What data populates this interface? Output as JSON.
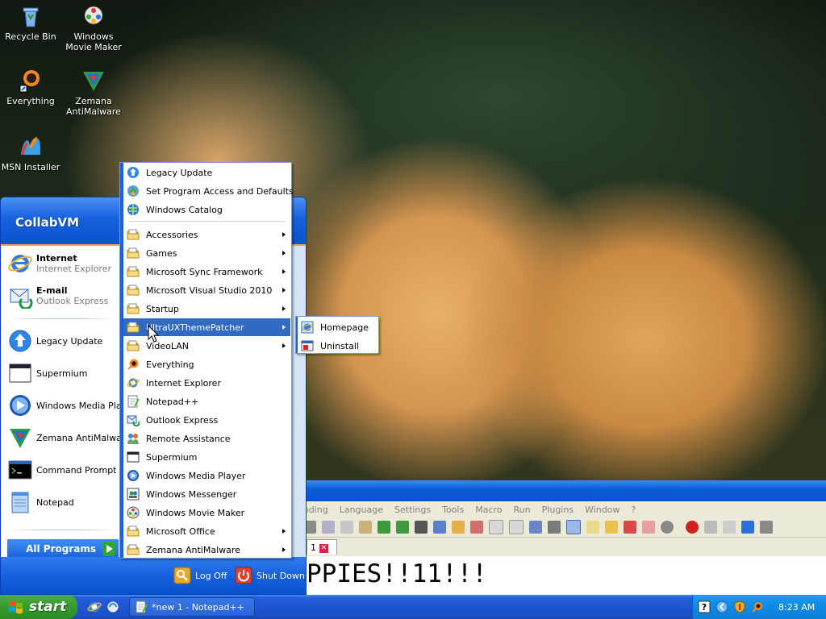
{
  "desktop": {
    "icons": [
      {
        "label": "Recycle Bin",
        "icon": "recycle-bin-icon"
      },
      {
        "label": "Windows Movie Maker",
        "icon": "movie-maker-icon"
      },
      {
        "label": "Everything",
        "icon": "everything-icon"
      },
      {
        "label": "Zemana AntiMalware",
        "icon": "zemana-icon"
      },
      {
        "label": "MSN Installer",
        "icon": "msn-icon"
      }
    ]
  },
  "notepadpp": {
    "menu": [
      "Encoding",
      "Language",
      "Settings",
      "Tools",
      "Macro",
      "Run",
      "Plugins",
      "Window",
      "?"
    ],
    "tab_label": "1",
    "editor_text": "PPIES!!11!!!"
  },
  "start_menu": {
    "user": "CollabVM",
    "pinned": [
      {
        "title": "Internet",
        "subtitle": "Internet Explorer",
        "icon": "internet-explorer-icon"
      },
      {
        "title": "E-mail",
        "subtitle": "Outlook Express",
        "icon": "outlook-express-icon"
      }
    ],
    "recent": [
      {
        "label": "Legacy Update",
        "icon": "legacy-update-icon"
      },
      {
        "label": "Supermium",
        "icon": "supermium-icon"
      },
      {
        "label": "Windows Media Player",
        "icon": "media-player-icon"
      },
      {
        "label": "Zemana AntiMalware",
        "icon": "zemana-icon"
      },
      {
        "label": "Command Prompt",
        "icon": "command-prompt-icon"
      },
      {
        "label": "Notepad",
        "icon": "notepad-icon"
      }
    ],
    "all_programs": "All Programs",
    "log_off": "Log Off",
    "shut_down": "Shut Down"
  },
  "programs_menu": {
    "top": [
      {
        "label": "Legacy Update",
        "icon": "legacy-update-icon"
      },
      {
        "label": "Set Program Access and Defaults",
        "icon": "defaults-icon"
      },
      {
        "label": "Windows Catalog",
        "icon": "catalog-icon"
      }
    ],
    "items": [
      {
        "label": "Accessories",
        "icon": "folder-icon",
        "submenu": true
      },
      {
        "label": "Games",
        "icon": "folder-icon",
        "submenu": true
      },
      {
        "label": "Microsoft Sync Framework",
        "icon": "folder-icon",
        "submenu": true
      },
      {
        "label": "Microsoft Visual Studio 2010",
        "icon": "folder-icon",
        "submenu": true
      },
      {
        "label": "Startup",
        "icon": "folder-icon",
        "submenu": true
      },
      {
        "label": "UltraUXThemePatcher",
        "icon": "folder-icon",
        "submenu": true,
        "highlighted": true
      },
      {
        "label": "VideoLAN",
        "icon": "folder-icon",
        "submenu": true
      },
      {
        "label": "Everything",
        "icon": "everything-icon"
      },
      {
        "label": "Internet Explorer",
        "icon": "internet-explorer-icon"
      },
      {
        "label": "Notepad++",
        "icon": "notepadpp-icon"
      },
      {
        "label": "Outlook Express",
        "icon": "outlook-express-icon"
      },
      {
        "label": "Remote Assistance",
        "icon": "remote-assistance-icon"
      },
      {
        "label": "Supermium",
        "icon": "supermium-icon"
      },
      {
        "label": "Windows Media Player",
        "icon": "media-player-icon"
      },
      {
        "label": "Windows Messenger",
        "icon": "messenger-icon"
      },
      {
        "label": "Windows Movie Maker",
        "icon": "movie-maker-icon"
      },
      {
        "label": "Microsoft Office",
        "icon": "folder-icon",
        "submenu": true
      },
      {
        "label": "Zemana AntiMalware",
        "icon": "folder-icon",
        "submenu": true
      }
    ]
  },
  "submenu": {
    "items": [
      {
        "label": "Homepage",
        "icon": "homepage-icon"
      },
      {
        "label": "Uninstall",
        "icon": "uninstall-icon"
      }
    ]
  },
  "taskbar": {
    "start_label": "start",
    "task_button": "*new 1 - Notepad++",
    "clock": "8:23 AM"
  }
}
